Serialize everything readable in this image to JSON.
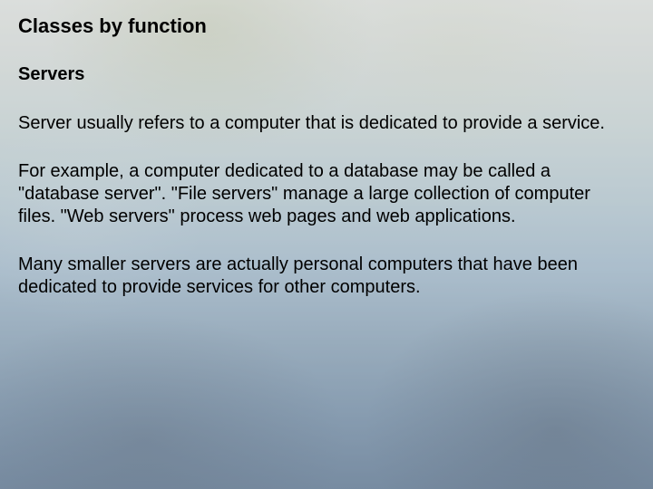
{
  "slide": {
    "title": "Classes by function",
    "subheading": "Servers",
    "paragraphs": {
      "p1": "Server usually refers to a computer that is dedicated to provide a service.",
      "p2": "For example, a computer dedicated to a database may be called a \"database server\". \"File servers\" manage a large collection of computer files. \"Web servers\" process web pages and web applications.",
      "p3": "Many smaller servers are actually personal computers that have been dedicated to provide services for other computers."
    }
  }
}
